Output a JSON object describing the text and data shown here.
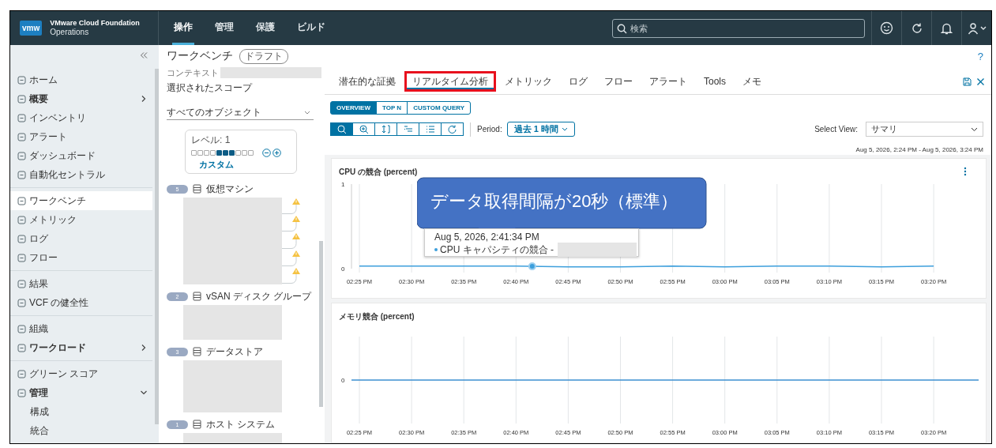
{
  "header": {
    "logo": "vmw",
    "product": "VMware Cloud Foundation",
    "subtitle": "Operations",
    "nav": [
      {
        "label": "操作",
        "selected": true
      },
      {
        "label": "管理",
        "selected": false
      },
      {
        "label": "保護",
        "selected": false
      },
      {
        "label": "ビルド",
        "selected": false
      }
    ],
    "search": {
      "placeholder": "検索"
    }
  },
  "sidebar": {
    "groups": [
      {
        "items": [
          {
            "label": "ホーム",
            "kind": "link",
            "selected": false
          },
          {
            "label": "概要",
            "kind": "section",
            "expanded": false,
            "selected": false
          },
          {
            "label": "インベントリ",
            "kind": "link",
            "selected": false
          },
          {
            "label": "アラート",
            "kind": "link",
            "selected": false
          },
          {
            "label": "ダッシュボード",
            "kind": "link",
            "selected": false
          },
          {
            "label": "自動化セントラル",
            "kind": "link",
            "selected": false
          }
        ]
      },
      {
        "items": [
          {
            "label": "ワークベンチ",
            "kind": "link",
            "selected": true
          },
          {
            "label": "メトリック",
            "kind": "link",
            "selected": false
          },
          {
            "label": "ログ",
            "kind": "link",
            "selected": false
          },
          {
            "label": "フロー",
            "kind": "link",
            "selected": false
          }
        ]
      },
      {
        "items": [
          {
            "label": "結果",
            "kind": "link",
            "selected": false
          },
          {
            "label": "VCF の健全性",
            "kind": "link",
            "selected": false
          }
        ]
      },
      {
        "items": [
          {
            "label": "組織",
            "kind": "link",
            "selected": false
          },
          {
            "label": "ワークロード",
            "kind": "section",
            "expanded": false,
            "selected": false
          }
        ]
      },
      {
        "items": [
          {
            "label": "グリーン スコア",
            "kind": "link",
            "selected": false
          },
          {
            "label": "管理",
            "kind": "section",
            "expanded": true,
            "selected": false,
            "children": [
              {
                "label": "構成",
                "kind": "link",
                "selected": false
              },
              {
                "label": "統合",
                "kind": "link",
                "selected": false
              }
            ]
          }
        ]
      }
    ]
  },
  "page": {
    "title": "ワークベンチ",
    "badge": "ドラフト",
    "help": "?"
  },
  "scope": {
    "context_label": "コンテキスト",
    "heading": "選択されたスコープ",
    "dropdown": "すべてのオブジェクト",
    "level": {
      "label": "レベル: 1",
      "cells": [
        {
          "filled": false
        },
        {
          "filled": false
        },
        {
          "filled": false
        },
        {
          "filled": false
        },
        {
          "filled": true
        },
        {
          "filled": true
        },
        {
          "filled": true
        },
        {
          "filled": false
        },
        {
          "filled": false
        },
        {
          "filled": false
        }
      ],
      "link": "カスタム"
    },
    "tree": [
      {
        "count": "5",
        "label": "仮想マシン",
        "items": [
          {
            "warning": true
          },
          {
            "warning": true
          },
          {
            "warning": true
          },
          {
            "warning": true
          },
          {
            "warning": true
          }
        ]
      },
      {
        "count": "2",
        "label": "vSAN ディスク グループ",
        "items": [
          {
            "warning": false
          },
          {
            "warning": false
          }
        ]
      },
      {
        "count": "3",
        "label": "データストア",
        "items": [
          {
            "warning": false
          },
          {
            "warning": false
          },
          {
            "warning": false
          }
        ]
      },
      {
        "count": "1",
        "label": "ホスト システム",
        "items": [
          {
            "warning": false
          }
        ]
      }
    ]
  },
  "main": {
    "tabs": [
      {
        "label": "潜在的な証拠",
        "selected": false,
        "highlighted": false
      },
      {
        "label": "リアルタイム分析",
        "selected": true,
        "highlighted": true
      },
      {
        "label": "メトリック",
        "selected": false,
        "highlighted": false
      },
      {
        "label": "ログ",
        "selected": false,
        "highlighted": false
      },
      {
        "label": "フロー",
        "selected": false,
        "highlighted": false
      },
      {
        "label": "アラート",
        "selected": false,
        "highlighted": false
      },
      {
        "label": "Tools",
        "selected": false,
        "highlighted": false
      },
      {
        "label": "メモ",
        "selected": false,
        "highlighted": false
      }
    ],
    "views": [
      {
        "label": "OVERVIEW",
        "selected": true
      },
      {
        "label": "TOP N",
        "selected": false
      },
      {
        "label": "CUSTOM QUERY",
        "selected": false
      }
    ],
    "toolbar": [
      {
        "selected": true
      },
      {
        "selected": false
      },
      {
        "selected": false
      },
      {
        "selected": false
      },
      {
        "selected": false
      },
      {
        "selected": false
      }
    ],
    "period": {
      "label": "Period:",
      "value": "過去 1 時間"
    },
    "select_view": {
      "label": "Select View:",
      "value": "サマリ"
    },
    "range": "Aug 5, 2026, 2:24 PM - Aug 5, 2026, 3:24 PM",
    "cpu_chart": {
      "chart_data": {
        "type": "line",
        "title": "CPU の競合 (percent)",
        "x": [
          "02:25 PM",
          "02:30 PM",
          "02:35 PM",
          "02:40 PM",
          "02:45 PM",
          "02:50 PM",
          "02:55 PM",
          "03:00 PM",
          "03:05 PM",
          "03:10 PM",
          "03:15 PM",
          "03:20 PM"
        ],
        "ylim": [
          0,
          1
        ],
        "yticks": [
          0,
          1
        ],
        "grid": true,
        "series": [
          {
            "color": "#3d9fdc",
            "values": [
              0.03,
              0.03,
              0.03,
              0.03,
              0.02,
              0.02,
              0.03,
              0.02,
              0.03,
              0.03,
              0.02,
              0.03
            ]
          }
        ]
      },
      "tooltip": {
        "time": "Aug 5, 2026, 2:41:34 PM",
        "series": "CPU キャパシティの競合 -"
      }
    },
    "memory_chart": {
      "title": "メモリ競合 (percent)",
      "y_label": "0",
      "x_labels": [
        "02:25 PM",
        "02:30 PM",
        "02:35 PM",
        "02:40 PM",
        "02:45 PM",
        "02:50 PM",
        "02:55 PM",
        "03:00 PM",
        "03:05 PM",
        "03:10 PM",
        "03:15 PM",
        "03:20 PM"
      ]
    },
    "callout": {
      "text": "データ取得間隔が20秒（標準）"
    }
  }
}
